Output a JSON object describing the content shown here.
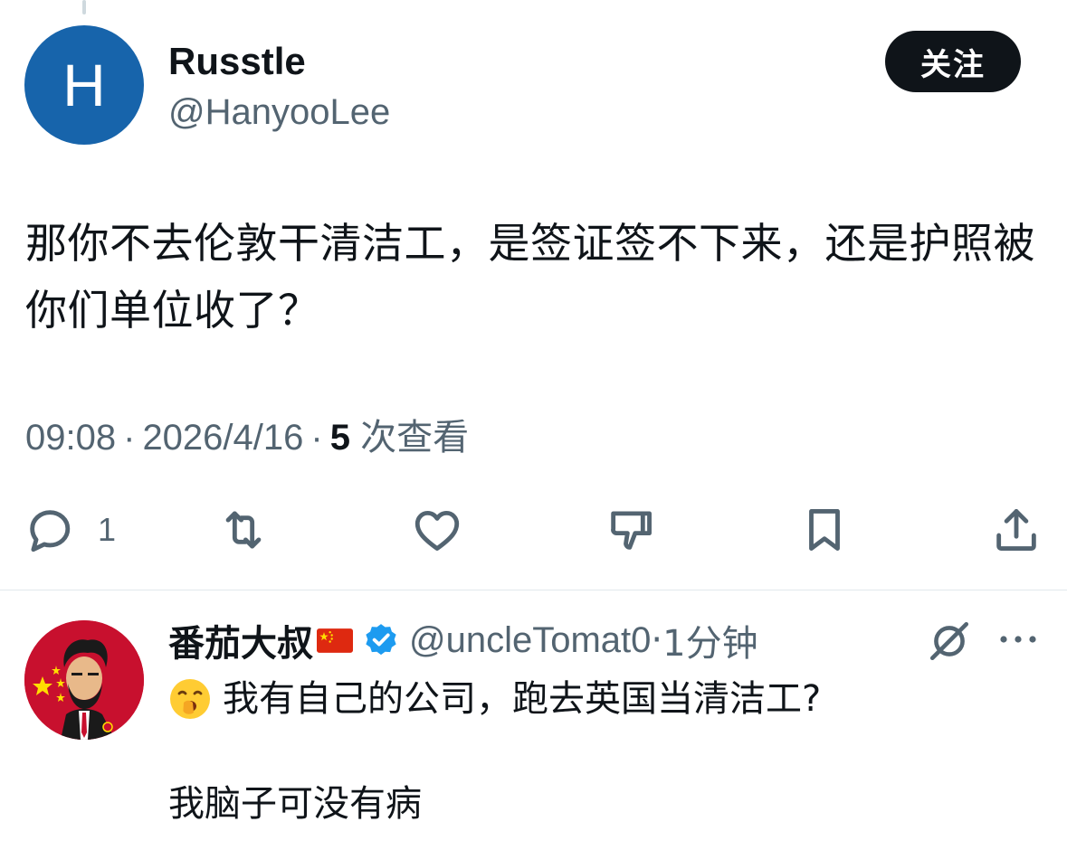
{
  "tweet": {
    "avatar_letter": "H",
    "display_name": "Russtle",
    "handle": "@HanyooLee",
    "follow_label": "关注",
    "text": "那你不去伦敦干清洁工，是签证签不下来，还是护照被你们单位收了？",
    "time": "09:08",
    "date": "2026/4/16",
    "separator": "·",
    "views_count": "5",
    "views_label": "次查看",
    "reply_count": "1"
  },
  "reply": {
    "display_name": "番茄大叔",
    "flag": "china-flag",
    "verified": true,
    "handle": "@uncleTomat0",
    "separator": "·",
    "time_ago": "1分钟",
    "emoji": "yawning-face-emoji",
    "line1": "我有自己的公司，跑去英国当清洁工?",
    "line2": "我脑子可没有病"
  },
  "colors": {
    "text_primary": "#0f1419",
    "text_secondary": "#536471",
    "follow_bg": "#0f1419",
    "avatar_bg": "#1764ab",
    "verified_blue": "#1d9bf0",
    "divider": "#e1e8ed"
  },
  "icons": [
    "reply-icon",
    "retweet-icon",
    "like-icon",
    "dislike-icon",
    "bookmark-icon",
    "share-icon",
    "mute-icon",
    "more-icon",
    "verified-badge-icon"
  ]
}
